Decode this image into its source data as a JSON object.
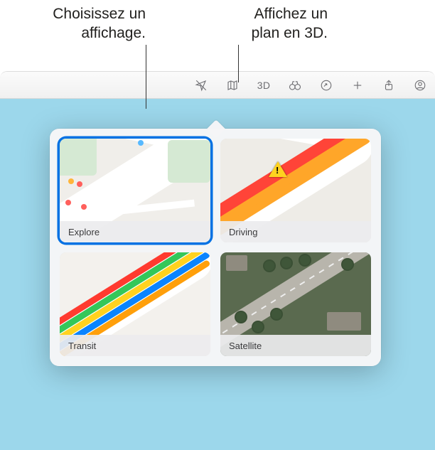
{
  "callouts": {
    "choose_view": "Choisissez un affichage.",
    "show_3d": "Affichez un plan en 3D."
  },
  "toolbar": {
    "label_3d": "3D"
  },
  "popover": {
    "tiles": {
      "explore": "Explore",
      "driving": "Driving",
      "transit": "Transit",
      "satellite": "Satellite"
    }
  }
}
